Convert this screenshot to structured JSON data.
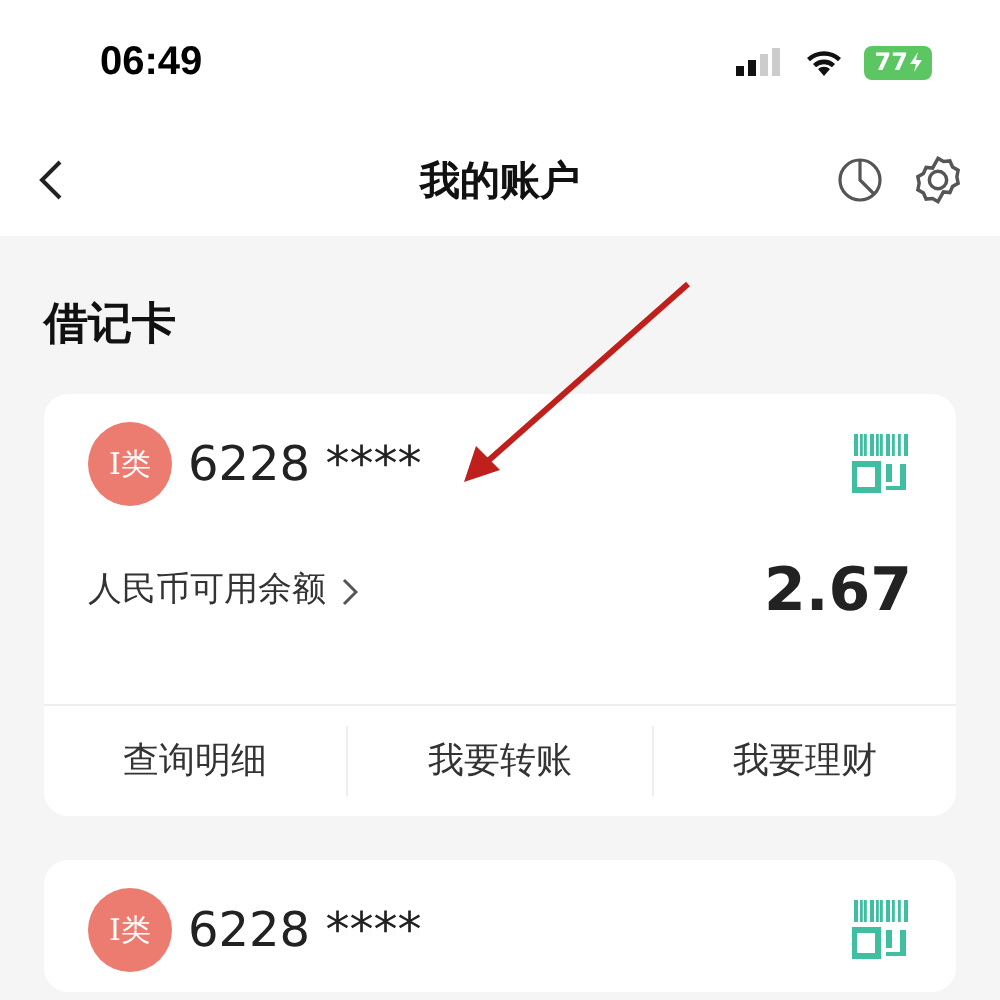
{
  "status_bar": {
    "time": "06:49",
    "battery": "77"
  },
  "nav": {
    "title": "我的账户"
  },
  "section_title": "借记卡",
  "cards": [
    {
      "badge": "I类",
      "number": "6228 ****",
      "balance_label": "人民币可用余额",
      "balance": "2.67",
      "actions": [
        "查询明细",
        "我要转账",
        "我要理财"
      ]
    },
    {
      "badge": "I类",
      "number": "6228 ****"
    }
  ]
}
